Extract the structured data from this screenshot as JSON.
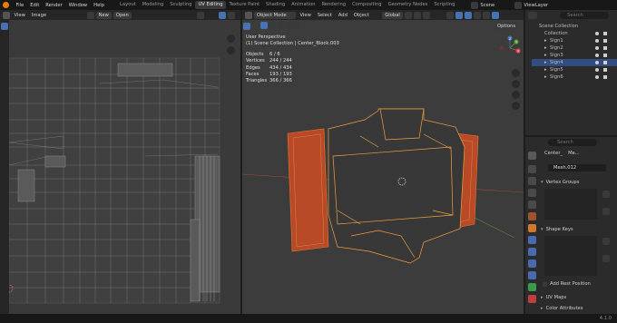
{
  "menu": [
    "File",
    "Edit",
    "Render",
    "Window",
    "Help"
  ],
  "workspaces": [
    "Layout",
    "Modeling",
    "Sculpting",
    "UV Editing",
    "Texture Paint",
    "Shading",
    "Animation",
    "Rendering",
    "Compositing",
    "Geometry Nodes",
    "Scripting"
  ],
  "active_workspace": "UV Editing",
  "scene": "Scene",
  "view_layer": "ViewLayer",
  "uv": {
    "view": "View",
    "image": "Image",
    "new": "New",
    "open": "Open"
  },
  "vp": {
    "mode": "Object Mode",
    "view": "View",
    "select": "Select",
    "add": "Add",
    "object": "Object",
    "orientation": "Global",
    "options": "Options",
    "title": "User Perspective",
    "subtitle": "(1) Scene Collection | Center_Block.003",
    "stats": [
      [
        "Objects",
        "6 / 6"
      ],
      [
        "Vertices",
        "244 / 244"
      ],
      [
        "Edges",
        "434 / 434"
      ],
      [
        "Faces",
        "193 / 193"
      ],
      [
        "Triangles",
        "366 / 366"
      ]
    ],
    "gizmo": {
      "x": "X",
      "y": "Y",
      "z": "Z"
    }
  },
  "outliner": {
    "search_placeholder": "Search",
    "root": "Scene Collection",
    "collection": "Collection",
    "items": [
      "Sign1",
      "Sign2",
      "Sign3",
      "Sign4",
      "Sign5",
      "Sign6"
    ],
    "selected_index": 3
  },
  "props": {
    "search_placeholder": "Search",
    "crumb_object": "Center_",
    "crumb_data": "Me...",
    "mesh": "Mesh.012",
    "sections": {
      "vertex_groups": "Vertex Groups",
      "shape_keys": "Shape Keys",
      "add_rest": "Add Rest Position",
      "uv_maps": "UV Maps",
      "color_attributes": "Color Attributes"
    }
  },
  "version": "4.1.0",
  "colors": {
    "accent": "#4772b3",
    "orange": "#e8762c",
    "selected_outline": "#f0a040"
  }
}
